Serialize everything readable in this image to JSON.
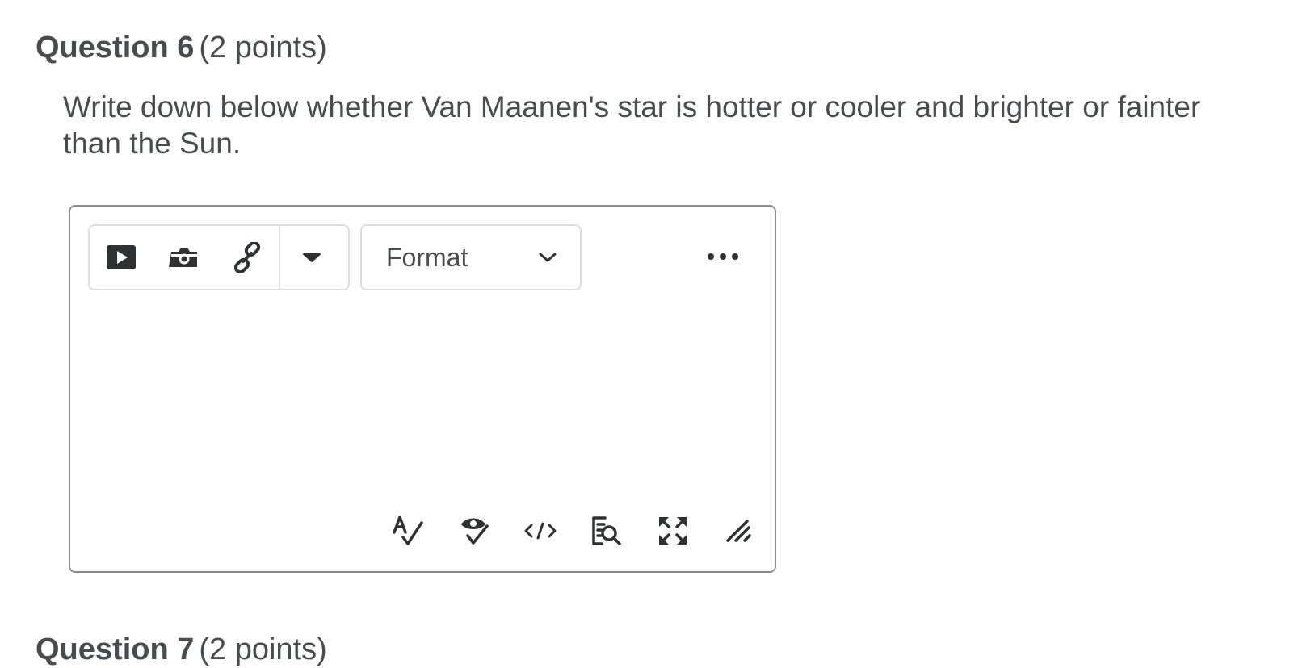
{
  "question": {
    "title": "Question 6",
    "points": "(2 points)",
    "text": "Write down below whether Van Maanen's star is hotter or cooler and brighter or fainter than the Sun."
  },
  "editor": {
    "toolbar": [
      {
        "name": "insert-video-button",
        "icon": "play-video-icon"
      },
      {
        "name": "insert-image-button",
        "icon": "camera-icon"
      },
      {
        "name": "insert-link-button",
        "icon": "link-icon"
      },
      {
        "name": "more-insert-options-button",
        "icon": "caret-down-icon"
      }
    ],
    "format_label": "Format",
    "more_icon": "ellipsis-icon",
    "bottom_toolbar": [
      {
        "name": "spellcheck-button",
        "icon": "spellcheck-icon"
      },
      {
        "name": "accessibility-check-button",
        "icon": "accessibility-check-icon"
      },
      {
        "name": "source-code-button",
        "icon": "code-icon"
      },
      {
        "name": "preview-button",
        "icon": "preview-search-icon"
      },
      {
        "name": "fullscreen-button",
        "icon": "fullscreen-icon"
      },
      {
        "name": "resize-handle",
        "icon": "resize-grip-icon"
      }
    ]
  },
  "next_question": {
    "title": "Question 7",
    "points": "(2 points)"
  },
  "colors": {
    "text": "#494c4e",
    "border": "#8a8c8f",
    "toolbar_border": "#dcdde0",
    "background": "#ffffff"
  }
}
